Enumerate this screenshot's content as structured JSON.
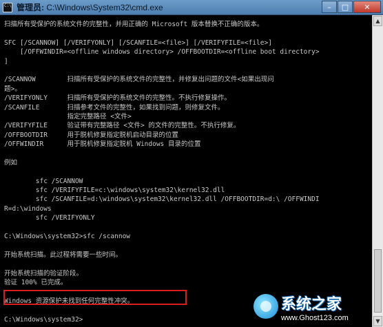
{
  "window": {
    "title_prefix": "管理员:",
    "title_path": "C:\\Windows\\System32\\cmd.exe",
    "controls": {
      "minimize": "–",
      "maximize": "□",
      "close": "✕"
    }
  },
  "console": {
    "lines": [
      "扫描所有受保护的系统文件的完整性，并用正确的 Microsoft 版本替换不正确的版本。",
      "",
      "SFC [/SCANNOW] [/VERIFYONLY] [/SCANFILE=<file>] [/VERIFYFILE=<file>]",
      "    [/OFFWINDIR=<offline windows directory> /OFFBOOTDIR=<offline boot directory>",
      "]",
      "",
      "/SCANNOW        扫描所有受保护的系统文件的完整性，并修复出问题的文件<如果出现问",
      "题>。",
      "/VERIFYONLY     扫描所有受保护的系统文件的完整性。不执行修复操作。",
      "/SCANFILE       扫描参考文件的完整性，如果找到问题，则修复文件。",
      "                指定完整路径 <文件>",
      "/VERIFYFILE     验证带有完整路径 <文件> 的文件的完整性。不执行修复。",
      "/OFFBOOTDIR     用于脱机修复指定脱机启动目录的位置",
      "/OFFWINDIR      用于脱机修复指定脱机 Windows 目录的位置",
      "",
      "例如",
      "",
      "        sfc /SCANNOW",
      "        sfc /VERIFYFILE=c:\\windows\\system32\\kernel32.dll",
      "        sfc /SCANFILE=d:\\windows\\system32\\kernel32.dll /OFFBOOTDIR=d:\\ /OFFWINDI",
      "R=d:\\windows",
      "        sfc /VERIFYONLY",
      "",
      "C:\\Windows\\system32>sfc /scannow",
      "",
      "开始系统扫描。此过程将需要一些时间。",
      "",
      "开始系统扫描的验证阶段。",
      "验证 100% 已完成。",
      "",
      "Windows 资源保护未找到任何完整性冲突。",
      "",
      "C:\\Windows\\system32>"
    ]
  },
  "watermark": {
    "name": "系统之家",
    "url": "www.Ghost123.com"
  }
}
